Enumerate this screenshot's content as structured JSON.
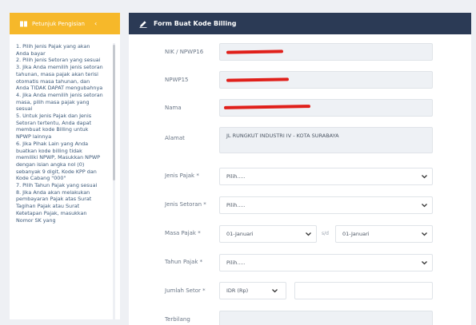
{
  "sidebar": {
    "header": "Petunjuk Pengisian",
    "items": [
      "1. Pilih Jenis Pajak yang akan Anda bayar",
      "2. Pilih Jenis Setoran yang sesuai",
      "3. Jika Anda memilih jenis setoran tahunan, masa pajak akan terisi otomatis masa tahunan, dan Anda TIDAK DAPAT mengubahnya",
      "4. Jika Anda memilih jenis setoran masa, pilih masa pajak yang sesuai",
      "5. Untuk Jenis Pajak dan Jenis Setoran tertentu, Anda dapat membuat kode Billing untuk NPWP lainnya",
      "6. Jika Pihak Lain yang Anda buatkan kode billing tidak memiliki NPWP, Masukkan NPWP dengan isian angka nol (0) sebanyak 9 digit, Kode KPP dan Kode Cabang \"000\"",
      "7. Pilih Tahun Pajak yang sesuai",
      "8. Jika Anda akan melakukan pembayaran Pajak atas Surat Tagihan Pajak atau Surat Ketetapan Pajak, masukkan Nomor SK yang"
    ]
  },
  "form": {
    "title": "Form Buat Kode Billing",
    "nik_label": "NIK / NPWP16",
    "npwp15_label": "NPWP15",
    "nama_label": "Nama",
    "alamat_label": "Alamat",
    "alamat_value": "JL RUNGKUT INDUSTRI IV - KOTA SURABAYA",
    "jenis_pajak_label": "Jenis Pajak *",
    "jenis_pajak_value": "Pilih.....",
    "jenis_setoran_label": "Jenis Setoran *",
    "jenis_setoran_value": "Pilih.....",
    "masa_pajak_label": "Masa Pajak *",
    "masa_pajak_from": "01-Januari",
    "masa_sd": "s/d",
    "masa_pajak_to": "01-Januari",
    "tahun_pajak_label": "Tahun Pajak *",
    "tahun_pajak_value": "Pilih.....",
    "jumlah_setor_label": "Jumlah Setor *",
    "currency_value": "IDR (Rp)",
    "terbilang_label": "Terbilang"
  },
  "colors": {
    "sidebar_header": "#f6b82a",
    "form_header": "#2b3a55",
    "redaction": "#e0201b"
  }
}
